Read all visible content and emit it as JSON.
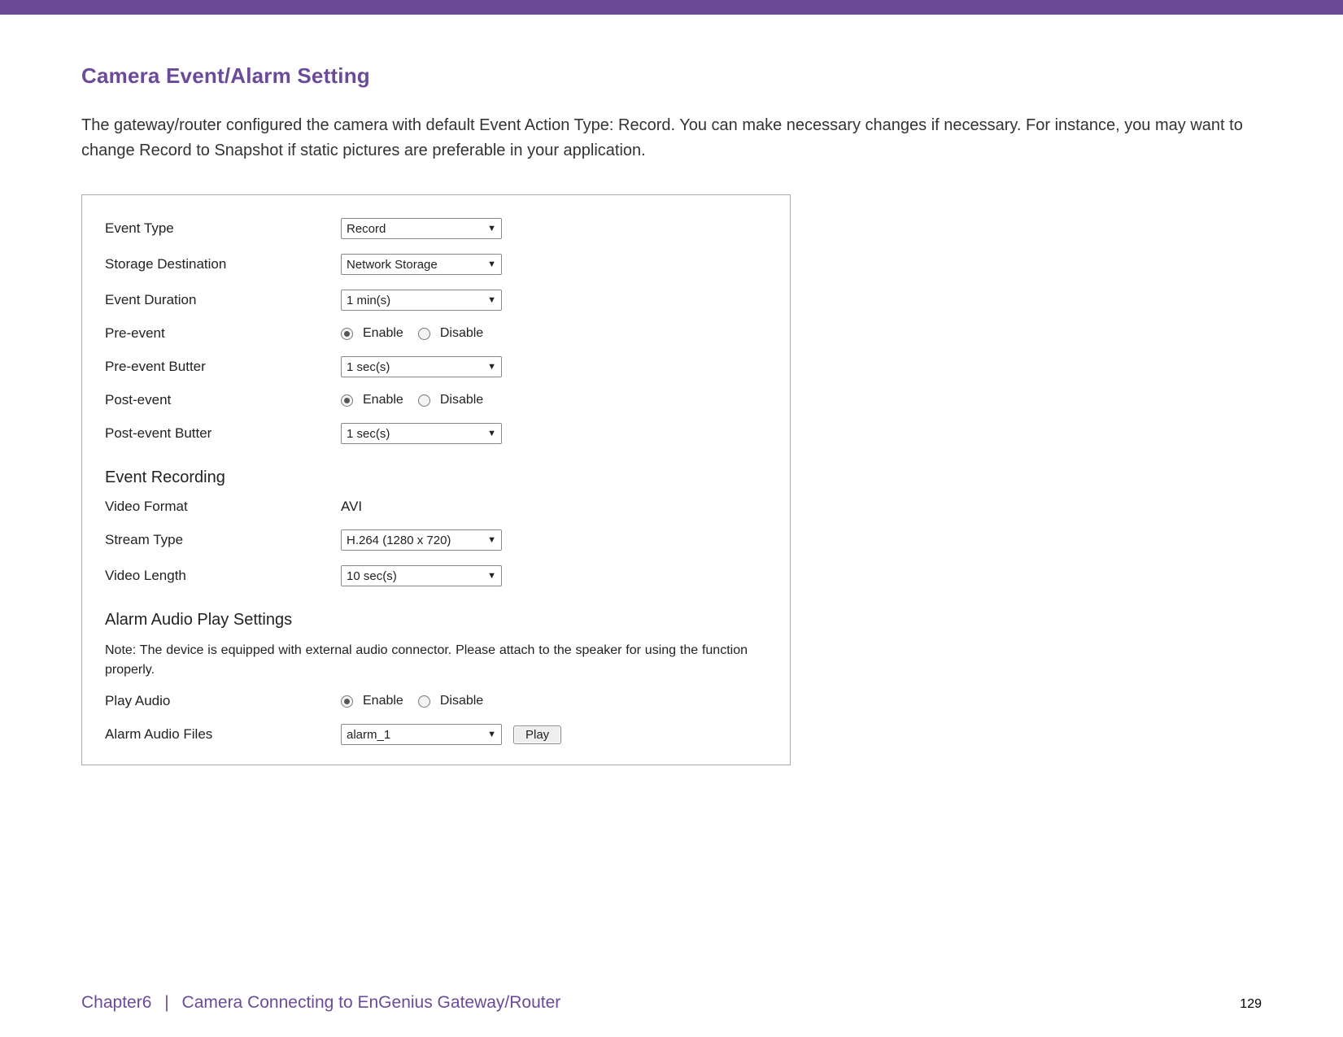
{
  "header": {
    "title": "Camera Event/Alarm Setting"
  },
  "intro": "The gateway/router configured the camera with default Event Action Type: Record. You can make necessary changes if necessary. For instance, you may want to change Record to Snapshot if static pictures are preferable in your application.",
  "form": {
    "eventType": {
      "label": "Event Type",
      "value": "Record"
    },
    "storageDestination": {
      "label": "Storage Destination",
      "value": "Network Storage"
    },
    "eventDuration": {
      "label": "Event Duration",
      "value": "1 min(s)"
    },
    "preEvent": {
      "label": "Pre-event",
      "enable": "Enable",
      "disable": "Disable"
    },
    "preEventButter": {
      "label": "Pre-event Butter",
      "value": "1 sec(s)"
    },
    "postEvent": {
      "label": "Post-event",
      "enable": "Enable",
      "disable": "Disable"
    },
    "postEventButter": {
      "label": "Post-event Butter",
      "value": "1 sec(s)"
    },
    "sectionEventRecording": "Event Recording",
    "videoFormat": {
      "label": "Video Format",
      "value": "AVI"
    },
    "streamType": {
      "label": "Stream Type",
      "value": "H.264 (1280 x 720)"
    },
    "videoLength": {
      "label": "Video Length",
      "value": "10 sec(s)"
    },
    "sectionAlarmAudio": "Alarm Audio Play Settings",
    "alarmNote": "Note: The device is equipped with external audio connector. Please attach to the speaker for using the function properly.",
    "playAudio": {
      "label": "Play Audio",
      "enable": "Enable",
      "disable": "Disable"
    },
    "alarmAudioFiles": {
      "label": "Alarm Audio Files",
      "value": "alarm_1",
      "playButton": "Play"
    }
  },
  "footer": {
    "chapter": "Chapter6",
    "sep": "|",
    "rest": "Camera Connecting to EnGenius Gateway/Router",
    "page": "129"
  }
}
